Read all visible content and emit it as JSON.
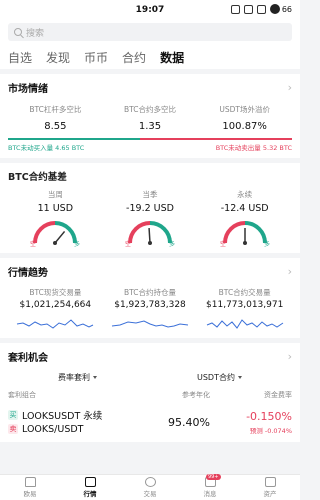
{
  "status": {
    "time": "19:07",
    "battery": "66"
  },
  "search": {
    "placeholder": "搜索"
  },
  "tabs": [
    "自选",
    "发现",
    "币币",
    "合约",
    "数据"
  ],
  "market": {
    "title": "市场情绪",
    "ratios": [
      {
        "label": "BTC杠杆多空比",
        "value": "8.55"
      },
      {
        "label": "BTC合约多空比",
        "value": "1.35"
      },
      {
        "label": "USDT场外溢价",
        "value": "100.87%"
      }
    ],
    "flow_in": "BTC未动买入量 4.65 BTC",
    "flow_out": "BTC未动卖出量 5.32 BTC",
    "flow_in_fraction": 0.466,
    "colors": {
      "green": "#1fa68b",
      "red": "#e5405c"
    }
  },
  "basis": {
    "title": "BTC合约基差",
    "gauges": [
      {
        "label": "当周",
        "value": "11 USD",
        "needle": 0.72
      },
      {
        "label": "当季",
        "value": "-19.2 USD",
        "needle": 0.48
      },
      {
        "label": "永续",
        "value": "-12.4 USD",
        "needle": 0.5
      }
    ],
    "short_label": "空",
    "long_label": "多"
  },
  "trend": {
    "title": "行情趋势",
    "items": [
      {
        "label": "BTC现货交易量",
        "value": "$1,021,254,664"
      },
      {
        "label": "BTC合约持仓量",
        "value": "$1,923,783,328"
      },
      {
        "label": "BTC合约交易量",
        "value": "$11,773,013,971"
      }
    ]
  },
  "arbitrage": {
    "title": "套利机会",
    "filter1": "费率套利",
    "filter2": "USDT合约",
    "col1": "套利组合",
    "col2": "参考年化",
    "col3": "资金费率",
    "row": {
      "buy_tag": "买",
      "sell_tag": "卖",
      "pair1": "LOOKSUSDT  永续",
      "pair2": "LOOKS/USDT",
      "apr": "95.40%",
      "rate": "-0.150%",
      "predicted": "预测 -0.074%"
    }
  },
  "nav": [
    {
      "label": "欧易",
      "icon": "home-icon"
    },
    {
      "label": "行情",
      "icon": "chart-icon"
    },
    {
      "label": "交易",
      "icon": "trade-icon"
    },
    {
      "label": "消息",
      "icon": "message-icon",
      "badge": "99+"
    },
    {
      "label": "资产",
      "icon": "wallet-icon"
    }
  ]
}
